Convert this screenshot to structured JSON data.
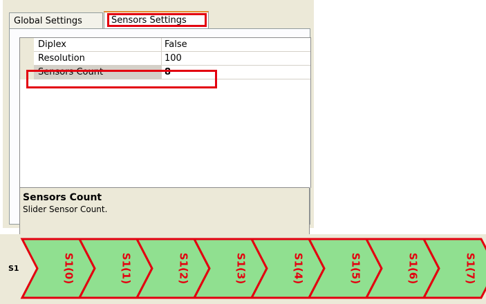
{
  "tabs": [
    {
      "label": "Global Settings"
    },
    {
      "label": "Sensors Settings"
    }
  ],
  "properties": [
    {
      "name": "Diplex",
      "value": "False"
    },
    {
      "name": "Resolution",
      "value": "100"
    },
    {
      "name": "Sensors Count",
      "value": "8"
    }
  ],
  "help": {
    "title": "Sensors Count",
    "description": "Slider Sensor Count."
  },
  "slider": {
    "label": "S1",
    "segments": [
      "S1(0)",
      "S1(1)",
      "S1(2)",
      "S1(3)",
      "S1(4)",
      "S1(5)",
      "S1(6)",
      "S1(7)"
    ],
    "fill_color": "#90e090",
    "outline_color": "#e3000f"
  }
}
